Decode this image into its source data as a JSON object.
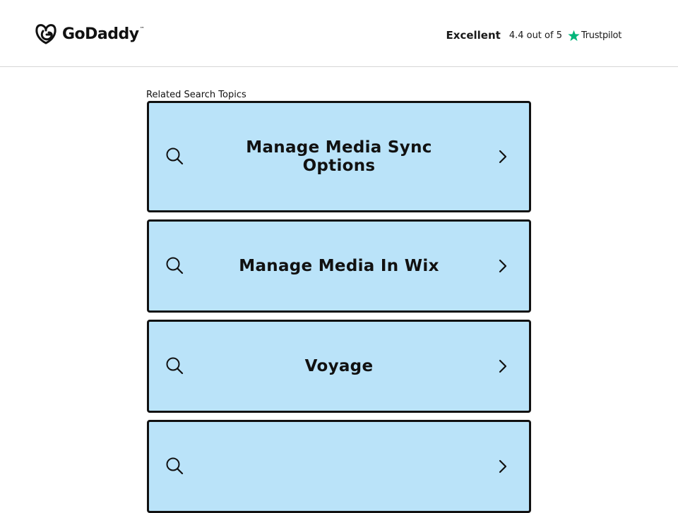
{
  "brand": {
    "name": "GoDaddy",
    "trademark": "™"
  },
  "rating": {
    "word": "Excellent",
    "score_text": "4.4 out of 5",
    "provider": "Trustpilot",
    "star_color": "#00b67a"
  },
  "related": {
    "label": "Related Search Topics",
    "card_color": "#bae3f9",
    "topics": [
      {
        "title": "Manage Media Sync Options",
        "icon": "search-icon",
        "action_icon": "chevron-right-icon"
      },
      {
        "title": "Manage Media In Wix",
        "icon": "search-icon",
        "action_icon": "chevron-right-icon"
      },
      {
        "title": "Voyage",
        "icon": "search-icon",
        "action_icon": "chevron-right-icon"
      },
      {
        "title": "",
        "icon": "search-icon",
        "action_icon": "chevron-right-icon"
      }
    ]
  }
}
